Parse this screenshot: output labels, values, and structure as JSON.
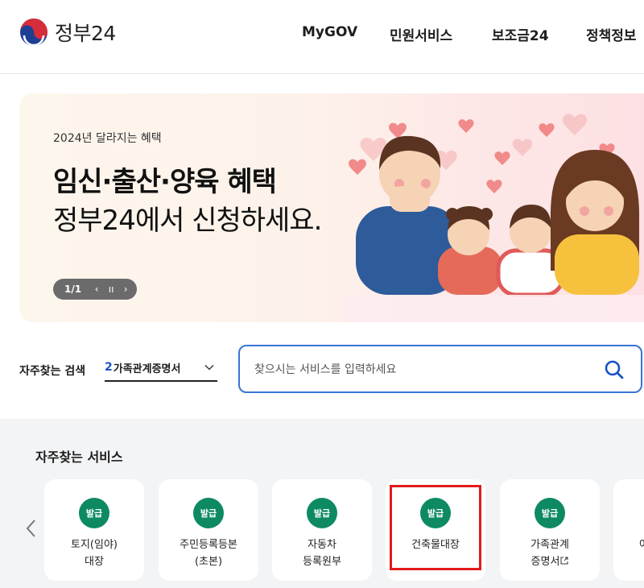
{
  "header": {
    "logo_text": "정부24",
    "nav": [
      {
        "label": "MyGOV"
      },
      {
        "label": "민원서비스"
      },
      {
        "label": "보조금24"
      },
      {
        "label": "정책정보"
      }
    ]
  },
  "banner": {
    "subtitle": "2024년 달라지는 혜택",
    "title": "임신·출산·양육 혜택",
    "description": "정부24에서 신청하세요.",
    "pagination": "1/1",
    "prev_glyph": "‹",
    "pause_glyph": "ıı",
    "next_glyph": "›"
  },
  "search": {
    "label": "자주찾는 검색",
    "select_number": "2",
    "select_value": "가족관계증명서",
    "placeholder": "찾으시는 서비스를 입력하세요"
  },
  "favorites": {
    "title": "자주찾는 서비스",
    "cards": [
      {
        "badge": "발급",
        "line1": "토지(임야)",
        "line2": "대장"
      },
      {
        "badge": "발급",
        "line1": "주민등록등본",
        "line2": "(초본)"
      },
      {
        "badge": "발급",
        "line1": "자동차",
        "line2": "등록원부"
      },
      {
        "badge": "발급",
        "line1": "건축물대장",
        "line2": ""
      },
      {
        "badge": "발급",
        "line1": "가족관계",
        "line2": "증명서"
      },
      {
        "badge": "",
        "line1": "여",
        "line2": ""
      }
    ]
  },
  "colors": {
    "accent_blue": "#3a73d6",
    "badge_green": "#0d8a63",
    "highlight_red": "#e21a1a"
  },
  "icons": [
    "taegeuk-logo-icon",
    "chevron-down-icon",
    "search-icon",
    "chevron-left-icon",
    "external-link-icon"
  ]
}
